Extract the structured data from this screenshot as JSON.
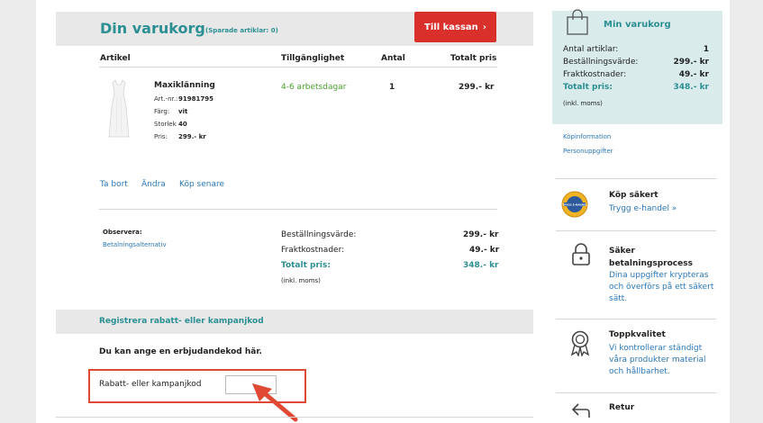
{
  "header": {
    "title": "Din varukorg",
    "saved_items": "(Sparade artiklar: 0)",
    "checkout_label": "Till kassan",
    "checkout_chevron": "›"
  },
  "table": {
    "columns": [
      "Artikel",
      "Tillgänglighet",
      "Antal",
      "Totalt pris"
    ]
  },
  "item": {
    "name": "Maxiklänning",
    "attributes": [
      {
        "label": "Art.-nr.:",
        "value": "91981795"
      },
      {
        "label": "Färg:",
        "value": "vit"
      },
      {
        "label": "Storlek",
        "value": "40"
      },
      {
        "label": "Pris:",
        "value": "299.- kr"
      }
    ],
    "availability": "4-6 arbetsdagar",
    "quantity": "1",
    "total": "299.- kr",
    "actions": [
      "Ta bort",
      "Ändra",
      "Köp senare"
    ]
  },
  "summary": {
    "note_label": "Observera:",
    "note_link": "Betalningsalternativ",
    "order_value_label": "Beställningsvärde:",
    "order_value": "299.- kr",
    "shipping_label": "Fraktkostnader:",
    "shipping": "49.- kr",
    "total_label": "Totalt pris:",
    "total": "348.- kr",
    "vat": "(inkl. moms)"
  },
  "promo": {
    "title": "Registrera rabatt- eller kampanjkod",
    "intro": "Du kan ange en erbjudandekod här.",
    "field_label": "Rabatt- eller kampanjkod",
    "value": ""
  },
  "sidebar": {
    "title": "Min varukorg",
    "count_label": "Antal artiklar:",
    "count": "1",
    "order_value_label": "Beställningsvärde:",
    "order_value": "299.- kr",
    "shipping_label": "Fraktkostnader:",
    "shipping": "49.- kr",
    "total_label": "Totalt pris:",
    "total": "348.- kr",
    "vat": "(inkl. moms)",
    "links": [
      "Köpinformation",
      "Personuppgifter"
    ],
    "features": [
      {
        "title": "Köp säkert",
        "text": "Trygg e-handel »",
        "icon": "trygg-ehandel-seal"
      },
      {
        "title": "Säker betalningsprocess",
        "text": "Dina uppgifter krypteras och överförs på ett säkert sätt.",
        "icon": "lock-icon"
      },
      {
        "title": "Toppkvalitet",
        "text": "Vi kontrollerar ständigt våra produkter material och hållbarhet.",
        "icon": "award-icon"
      },
      {
        "title": "Retur",
        "text": "",
        "icon": "return-arrow-icon"
      }
    ],
    "seal_text": "TRYGG E-HANDEL"
  },
  "colors": {
    "accent": "#2c8f93",
    "checkout": "#d9302b",
    "availability": "#4a9f2f",
    "link": "#2a77b8",
    "annotation": "#e04a35"
  }
}
